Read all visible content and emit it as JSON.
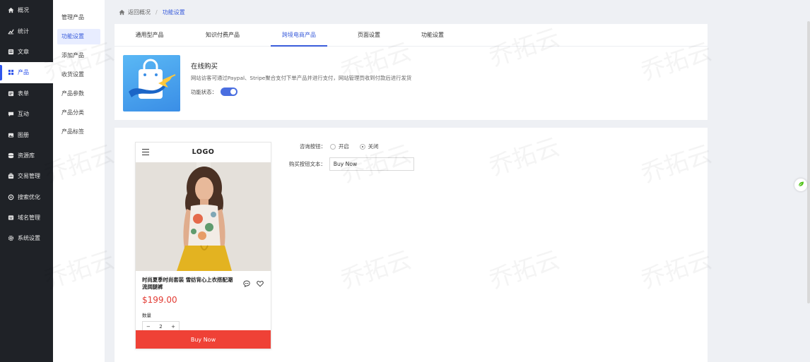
{
  "sidebar": {
    "items": [
      {
        "label": "概况",
        "icon": "home-icon"
      },
      {
        "label": "统计",
        "icon": "stats-icon"
      },
      {
        "label": "文章",
        "icon": "article-icon"
      },
      {
        "label": "产品",
        "icon": "grid-icon"
      },
      {
        "label": "表单",
        "icon": "form-icon"
      },
      {
        "label": "互动",
        "icon": "chat-icon"
      },
      {
        "label": "图册",
        "icon": "album-icon"
      },
      {
        "label": "资源库",
        "icon": "database-icon"
      },
      {
        "label": "交易管理",
        "icon": "trade-icon"
      },
      {
        "label": "搜索优化",
        "icon": "seo-icon"
      },
      {
        "label": "域名管理",
        "icon": "domain-icon"
      },
      {
        "label": "系统设置",
        "icon": "gear-icon"
      }
    ],
    "active_index": 3,
    "accent": "#2f54eb"
  },
  "submenu": {
    "items": [
      "管理产品",
      "功能设置",
      "添加产品",
      "收货设置",
      "产品参数",
      "产品分类",
      "产品标签"
    ],
    "active_index": 1
  },
  "breadcrumb": {
    "back_label": "返回概况",
    "separator": "/",
    "current": "功能设置"
  },
  "tabs": {
    "items": [
      "通用型产品",
      "知识付费产品",
      "跨境电商产品",
      "页面设置",
      "功能设置"
    ],
    "active_index": 2
  },
  "feature": {
    "title": "在线购买",
    "description": "网站访客可通过Paypal、Stripe聚合支付下单产品并进行支付，网站管理员收到付款后进行发货",
    "status_label": "功能状态：",
    "status_on": true
  },
  "preview": {
    "logo": "LOGO",
    "product_title": "时尚夏季时尚套装 雪纺背心上衣搭配潮流阔腿裤",
    "price": "$199.00",
    "qty_label": "数量",
    "qty_minus": "−",
    "qty_value": "2",
    "qty_plus": "+",
    "buy_label": "Buy Now"
  },
  "form": {
    "consult_label": "咨询按钮：",
    "consult_options": [
      "开启",
      "关闭"
    ],
    "consult_selected": 1,
    "buy_text_label": "购买按钮文本：",
    "buy_text_value": "Buy Now"
  },
  "watermark": "乔拓云",
  "colors": {
    "accent": "#3a5ddb",
    "buy_button": "#ef4136",
    "price": "#e23b33",
    "sidebar_bg": "#1f2227"
  }
}
